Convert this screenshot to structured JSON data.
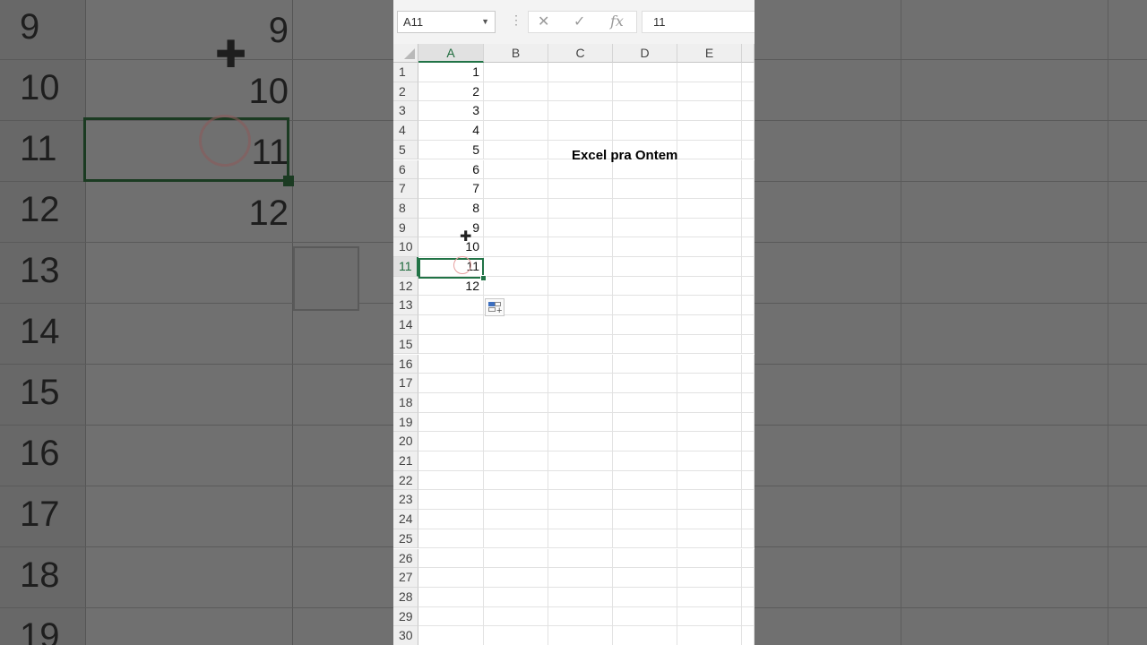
{
  "namebox": {
    "value": "A11",
    "chevron": "chevron-down-icon"
  },
  "formula_bar": {
    "value": "11",
    "cancel": "✕",
    "enter": "✓",
    "fx": "fx"
  },
  "columns": [
    "A",
    "B",
    "C",
    "D",
    "E"
  ],
  "rows": [
    "1",
    "2",
    "3",
    "4",
    "5",
    "6",
    "7",
    "8",
    "9",
    "10",
    "11",
    "12",
    "13",
    "14",
    "15",
    "16",
    "17",
    "18",
    "19",
    "20",
    "21",
    "22",
    "23",
    "24",
    "25",
    "26",
    "27",
    "28",
    "29",
    "30"
  ],
  "col_a_values": [
    "1",
    "2",
    "3",
    "4",
    "5",
    "6",
    "7",
    "8",
    "9",
    "10",
    "11",
    "12"
  ],
  "annotation": "Excel pra Ontem",
  "background_zoom": {
    "row_numbers": [
      "9",
      "10",
      "11",
      "12",
      "13",
      "14",
      "15",
      "16",
      "17",
      "18",
      "19"
    ],
    "values": [
      "9",
      "10",
      "11",
      "12"
    ]
  },
  "colors": {
    "accent": "#217346"
  }
}
